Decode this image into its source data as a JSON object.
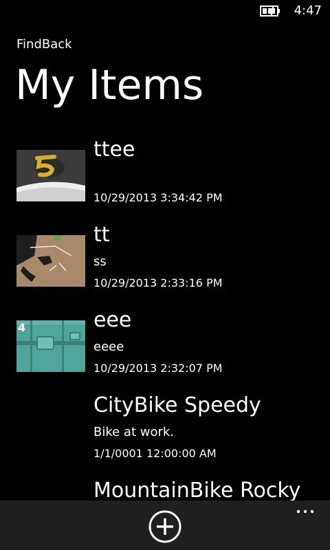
{
  "status_bar": {
    "time": "4:47",
    "battery_icon": "battery-charging-icon"
  },
  "header": {
    "app_name": "FindBack",
    "title": "My Items"
  },
  "items": [
    {
      "title": "ttee",
      "description": "",
      "date": "10/29/2013 3:34:42 PM",
      "thumbnail": "number-five-on-track-photo"
    },
    {
      "title": "tt",
      "description": "ss",
      "date": "10/29/2013 2:33:16 PM",
      "thumbnail": "chalk-outline-shadow-photo"
    },
    {
      "title": "eee",
      "description": "eeee",
      "date": "10/29/2013 2:32:07 PM",
      "thumbnail": "teal-container-door-photo"
    },
    {
      "title": "CityBike Speedy",
      "description": "Bike at work.",
      "date": "1/1/0001 12:00:00 AM",
      "thumbnail": ""
    },
    {
      "title": "MountainBike Rocky",
      "description": "",
      "date": "",
      "thumbnail": ""
    }
  ],
  "app_bar": {
    "add_icon": "add-circle-icon",
    "more_icon": "ellipsis-icon",
    "background": "#1f1f1f"
  },
  "colors": {
    "background": "#000000",
    "text": "#ffffff"
  }
}
